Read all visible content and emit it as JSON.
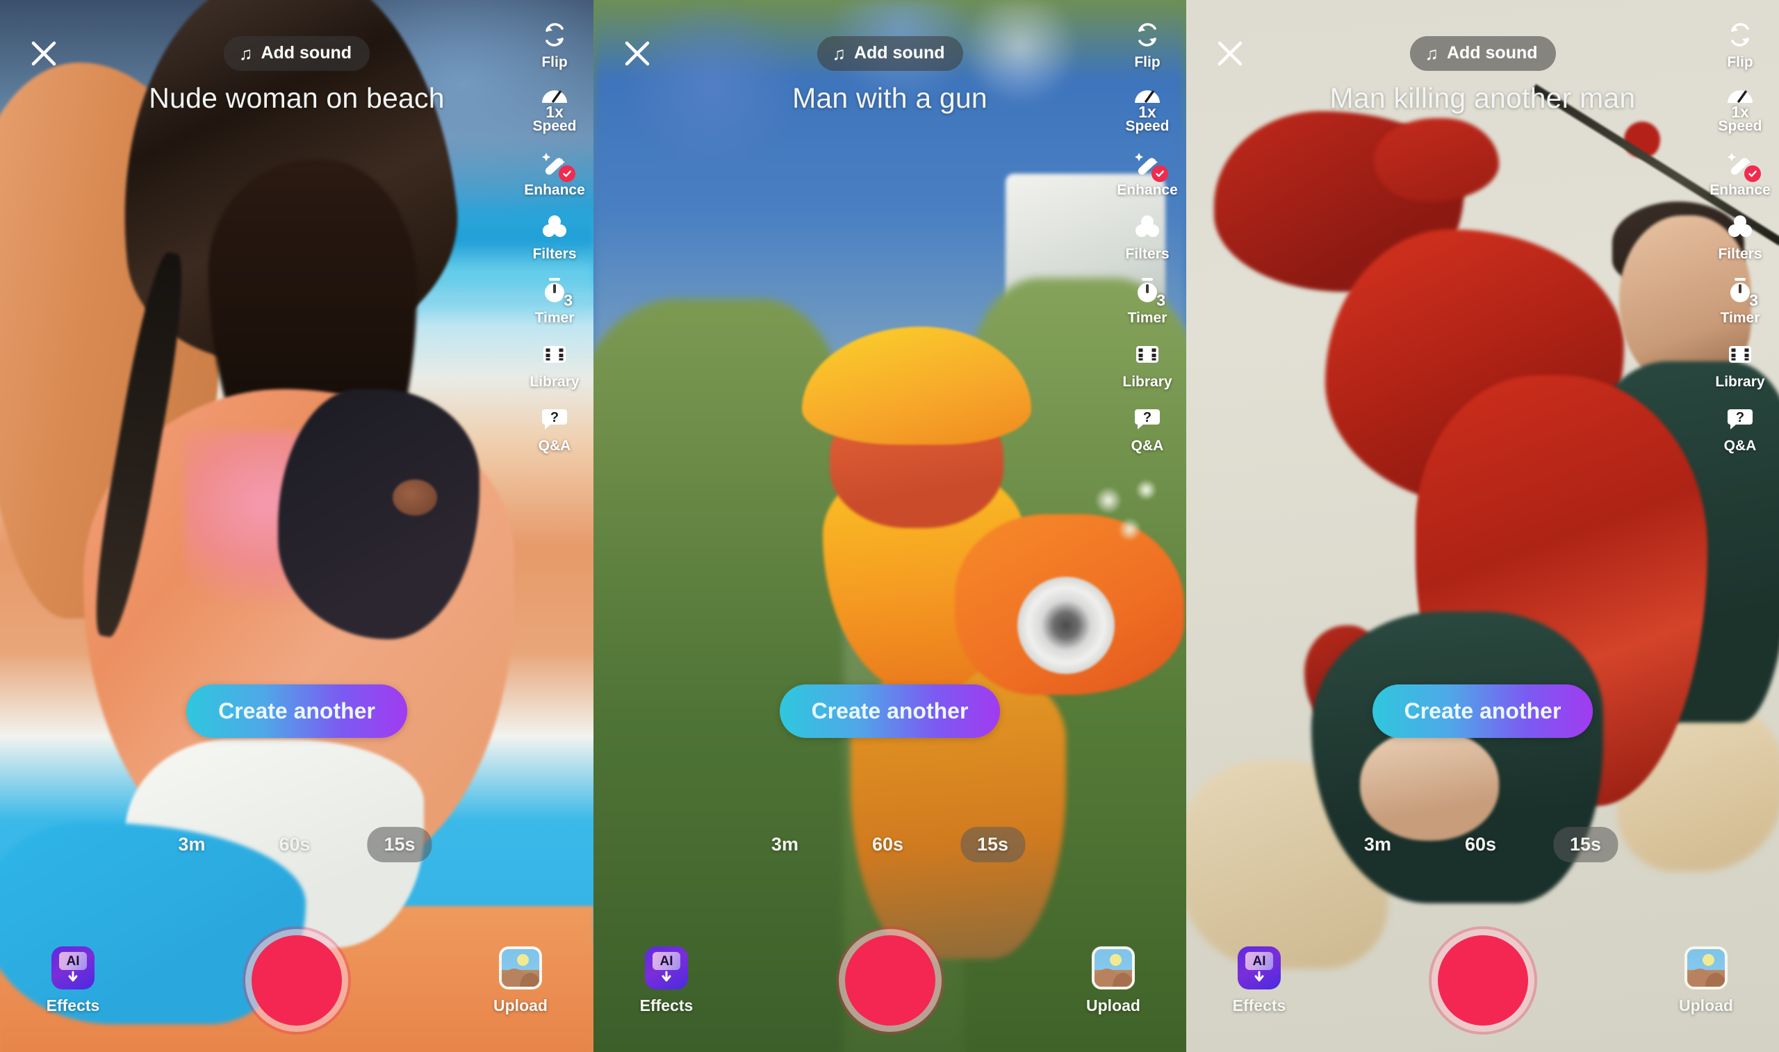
{
  "app": {
    "name": "TikTok camera screen",
    "accent_record": "#F32752",
    "accent_gradient_start": "#2FC7DE",
    "accent_gradient_end": "#A13BF0",
    "enhance_badge_color": "#F02C4E"
  },
  "common": {
    "close_icon": "close-icon",
    "add_sound": {
      "label": "Add sound",
      "icon": "music-note-icon",
      "glyph": "♫"
    },
    "rail": [
      {
        "label": "Flip",
        "icon": "flip-camera-icon"
      },
      {
        "label": "Speed",
        "icon": "speedometer-icon",
        "badge": "1x"
      },
      {
        "label": "Enhance",
        "icon": "beauty-wand-icon",
        "badge": "check"
      },
      {
        "label": "Filters",
        "icon": "filters-circles-icon"
      },
      {
        "label": "Timer",
        "icon": "timer-icon",
        "badge": "3"
      },
      {
        "label": "Library",
        "icon": "film-strip-icon"
      },
      {
        "label": "Q&A",
        "icon": "question-bubble-icon",
        "glyph": "?"
      }
    ],
    "create_another_label": "Create another",
    "durations": [
      {
        "label": "3m",
        "active": false
      },
      {
        "label": "60s",
        "active": false
      },
      {
        "label": "15s",
        "active": true
      }
    ],
    "bottom": {
      "effects_label": "Effects",
      "effects_icon": "ai-effects-icon",
      "effects_badge_text": "AI",
      "record_icon": "record-button",
      "upload_label": "Upload",
      "upload_icon": "photo-upload-icon"
    }
  },
  "panels": [
    {
      "id": "panel-1",
      "prompt": "Nude woman on beach"
    },
    {
      "id": "panel-2",
      "prompt": "Man with a gun"
    },
    {
      "id": "panel-3",
      "prompt": "Man killing another man"
    }
  ]
}
